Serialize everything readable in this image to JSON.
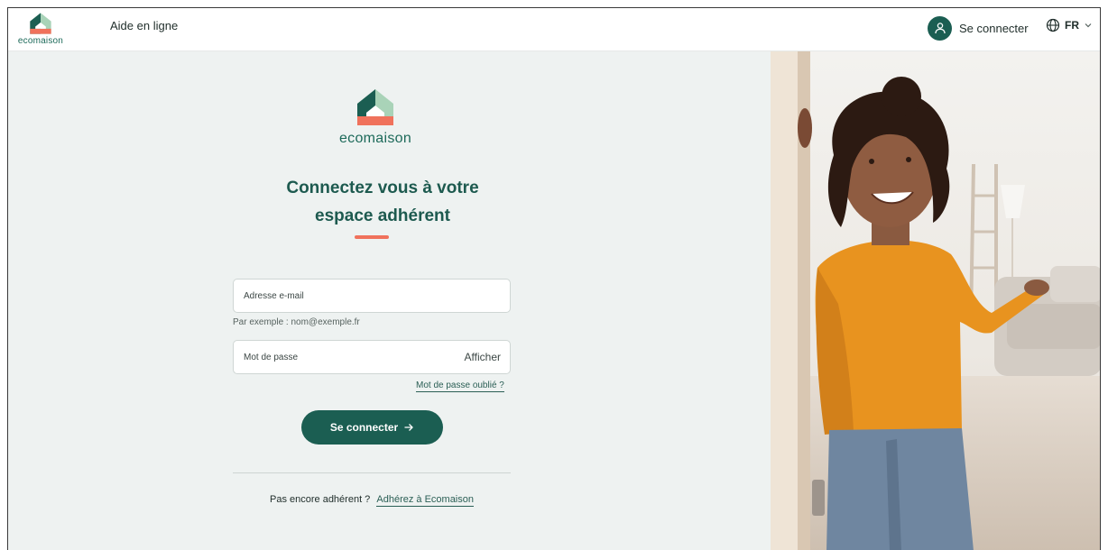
{
  "brand": {
    "name": "ecomaison",
    "colors": {
      "primary": "#1b5e52",
      "accent": "#f0725c",
      "light_green": "#a9d3b8"
    }
  },
  "header": {
    "help_label": "Aide en ligne",
    "login_label": "Se connecter",
    "language": "FR",
    "icons": [
      "user-icon",
      "globe-icon",
      "chevron-down-icon"
    ]
  },
  "login": {
    "title_line1": "Connectez vous à votre",
    "title_line2": "espace adhérent",
    "email": {
      "placeholder": "Adresse e-mail",
      "value": "",
      "hint": "Par exemple : nom@exemple.fr"
    },
    "password": {
      "placeholder": "Mot de passe",
      "value": "",
      "show_label": "Afficher"
    },
    "forgot_label": "Mot de passe oublié ?",
    "submit_label": "Se connecter",
    "signup_prompt": "Pas encore adhérent ?",
    "signup_link": "Adhérez à Ecomaison"
  }
}
